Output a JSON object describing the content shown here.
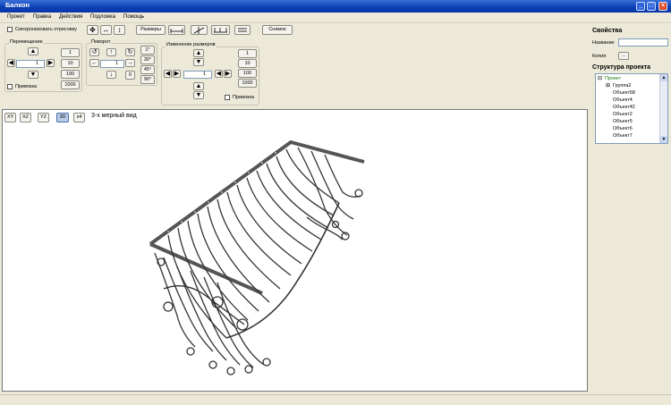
{
  "window": {
    "title": "Балкон",
    "controls": [
      "_",
      "□",
      "×"
    ]
  },
  "menu": [
    "Проект",
    "Правка",
    "Действия",
    "Подложка",
    "Помощь"
  ],
  "toolbar": {
    "sync_label": "Синхронизовать отрисовку",
    "sizes_label": "Размеры",
    "snapshot_label": "Снимок",
    "icons": [
      "move-icon",
      "stretch-horizontal-icon",
      "stretch-vertical-icon",
      "dimension-icon",
      "angle-dimension-icon",
      "divide-icon",
      "list-icon"
    ]
  },
  "move_group": {
    "title": "Перемещение",
    "value": "1",
    "steps": [
      "1",
      "10",
      "100",
      "1000"
    ],
    "snap_label": "Привязка"
  },
  "rotate_group": {
    "title": "Поворот",
    "value": "1",
    "zero_label": "0",
    "angles": [
      "1°",
      "30°",
      "45°",
      "90°"
    ]
  },
  "resize_group": {
    "title": "Изменение размеров",
    "value": "1",
    "steps": [
      "1",
      "10",
      "100",
      "1000"
    ],
    "snap_label": "Привязка"
  },
  "viewport": {
    "buttons": [
      "XY",
      "XZ",
      "YZ",
      "3D",
      "x4"
    ],
    "active": "3D",
    "caption": "3-х мерный вид"
  },
  "properties": {
    "heading": "Свойства",
    "name_label": "Название",
    "name_value": "",
    "copy_label": "Копия",
    "copy_button": "..."
  },
  "structure": {
    "heading": "Структура проекта",
    "items": [
      "Проект",
      "Группа2",
      "Объект58",
      "Объект4",
      "Объект42",
      "Объект2",
      "Объект5",
      "Объект6",
      "Объект7"
    ]
  }
}
